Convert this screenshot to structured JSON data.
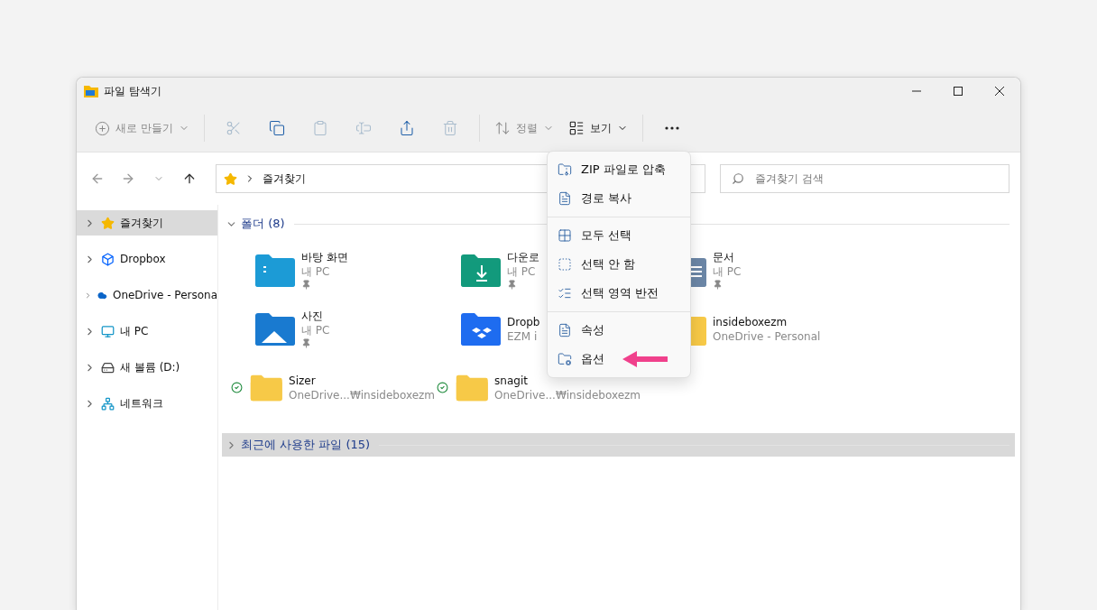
{
  "window": {
    "title": "파일 탐색기"
  },
  "toolbar": {
    "new": {
      "label": "새로 만들기",
      "disabled": true
    },
    "actions": [
      {
        "kind": "cut",
        "disabled": true
      },
      {
        "kind": "copy",
        "disabled": false
      },
      {
        "kind": "paste",
        "disabled": true
      },
      {
        "kind": "rename",
        "disabled": true
      },
      {
        "kind": "share",
        "disabled": false
      },
      {
        "kind": "delete",
        "disabled": true
      }
    ],
    "sort": {
      "label": "정렬",
      "disabled": true
    },
    "view": {
      "label": "보기",
      "disabled": false
    }
  },
  "address": {
    "path": "즐겨찾기"
  },
  "search": {
    "placeholder": "즐겨찾기 검색"
  },
  "sidebar": {
    "items": [
      {
        "label": "즐겨찾기",
        "kind": "star",
        "selected": true
      },
      {
        "label": "Dropbox",
        "kind": "dropbox",
        "selected": false
      },
      {
        "label": "OneDrive - Persona",
        "kind": "cloud",
        "selected": false
      },
      {
        "label": "내 PC",
        "kind": "pc",
        "selected": false
      },
      {
        "label": "새 볼륨 (D:)",
        "kind": "drive",
        "selected": false
      },
      {
        "label": "네트워크",
        "kind": "network",
        "selected": false
      }
    ]
  },
  "sections": [
    {
      "title": "폴더 (8)",
      "expanded": true,
      "selected": false,
      "items": [
        {
          "name": "바탕 화면",
          "sub": "내 PC",
          "kind": "desktop",
          "pinned": true,
          "synced": false
        },
        {
          "name": "다운로",
          "sub": "내 PC",
          "kind": "downloads",
          "pinned": true,
          "synced": false
        },
        {
          "name": "문서",
          "sub": "내 PC",
          "kind": "documents",
          "pinned": true,
          "synced": false
        },
        {
          "name": "사진",
          "sub": "내 PC",
          "kind": "pictures",
          "pinned": true,
          "synced": false
        },
        {
          "name": "Dropb",
          "sub": "EZM i",
          "kind": "dropbox",
          "pinned": false,
          "synced": false
        },
        {
          "name": "insideboxezm",
          "sub": "OneDrive - Personal",
          "kind": "folder",
          "pinned": false,
          "synced": false
        },
        {
          "name": "Sizer",
          "sub": "OneDrive...₩insideboxezm",
          "kind": "folder",
          "pinned": false,
          "synced": true
        },
        {
          "name": "snagit",
          "sub": "OneDrive...₩insideboxezm",
          "kind": "folder",
          "pinned": false,
          "synced": true
        }
      ]
    },
    {
      "title": "최근에 사용한 파일 (15)",
      "expanded": false,
      "selected": true
    }
  ],
  "menu": {
    "groups": [
      [
        {
          "label": "ZIP 파일로 압축",
          "kind": "zip",
          "highlighted": false
        },
        {
          "label": "경로 복사",
          "kind": "path",
          "highlighted": false
        }
      ],
      [
        {
          "label": "모두 선택",
          "kind": "select-all",
          "highlighted": false
        },
        {
          "label": "선택 안 함",
          "kind": "select-none",
          "highlighted": false
        },
        {
          "label": "선택 영역 반전",
          "kind": "invert",
          "highlighted": false
        }
      ],
      [
        {
          "label": "속성",
          "kind": "properties",
          "highlighted": false
        },
        {
          "label": "옵션",
          "kind": "options",
          "highlighted": true
        }
      ]
    ]
  }
}
